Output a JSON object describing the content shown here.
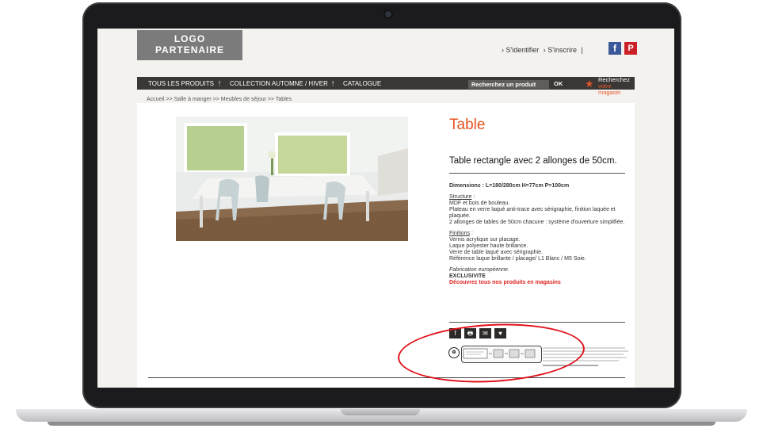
{
  "header": {
    "logo_line1": "LOGO",
    "logo_line2": "PARTENAIRE",
    "signin": "› S'identifier",
    "signup": "› S'inscrire",
    "separator": "|",
    "facebook_glyph": "f",
    "pinterest_glyph": "P"
  },
  "nav": {
    "items": [
      "TOUS LES PRODUITS",
      "COLLECTION AUTOMNE / HIVER",
      "CATALOGUE"
    ],
    "divider": "!",
    "search_placeholder": "Recherchez un produit",
    "ok_label": "OK",
    "store_line1": "Recherchez",
    "store_line2": "votre magasin"
  },
  "breadcrumb": "Accueil >> Salle à manger >> Meubles de séjour >> Tables",
  "product": {
    "title": "Table",
    "subtitle": "Table rectangle avec 2 allonges de 50cm.",
    "dimensions": "Dimensions : L=180/280cm H=77cm P=100cm",
    "structure_heading": "Structure",
    "structure_colon": " :",
    "structure_lines": [
      "MDF et bois de bouleau.",
      "Plateau en verre laqué anti-trace avec sérigraphie, finition laquée et plaquée.",
      "2 allonges de tables de 50cm chacune : système d'ouverture simplifiée."
    ],
    "finitions_heading": "Finitions",
    "finitions_colon": " :",
    "finitions_lines": [
      "Vernis acrylique sur placage.",
      "Laque polyester haute brillance.",
      "Verre de table laqué avec sérigraphie.",
      "Référence laque brillante / placage/ L1 Blanc / M5 Soie."
    ],
    "origin": "Fabrication européenne.",
    "exclusive": "EXCLUSIVITE",
    "stores_cta": "Découvrez tous nos produits en magasins"
  },
  "share": {
    "facebook": "f",
    "print": "🖶",
    "email": "✉",
    "favorite": "♥"
  },
  "colors": {
    "accent_orange": "#e4531f",
    "nav_dark": "#3a3735",
    "annotation_red": "#e0111a"
  }
}
